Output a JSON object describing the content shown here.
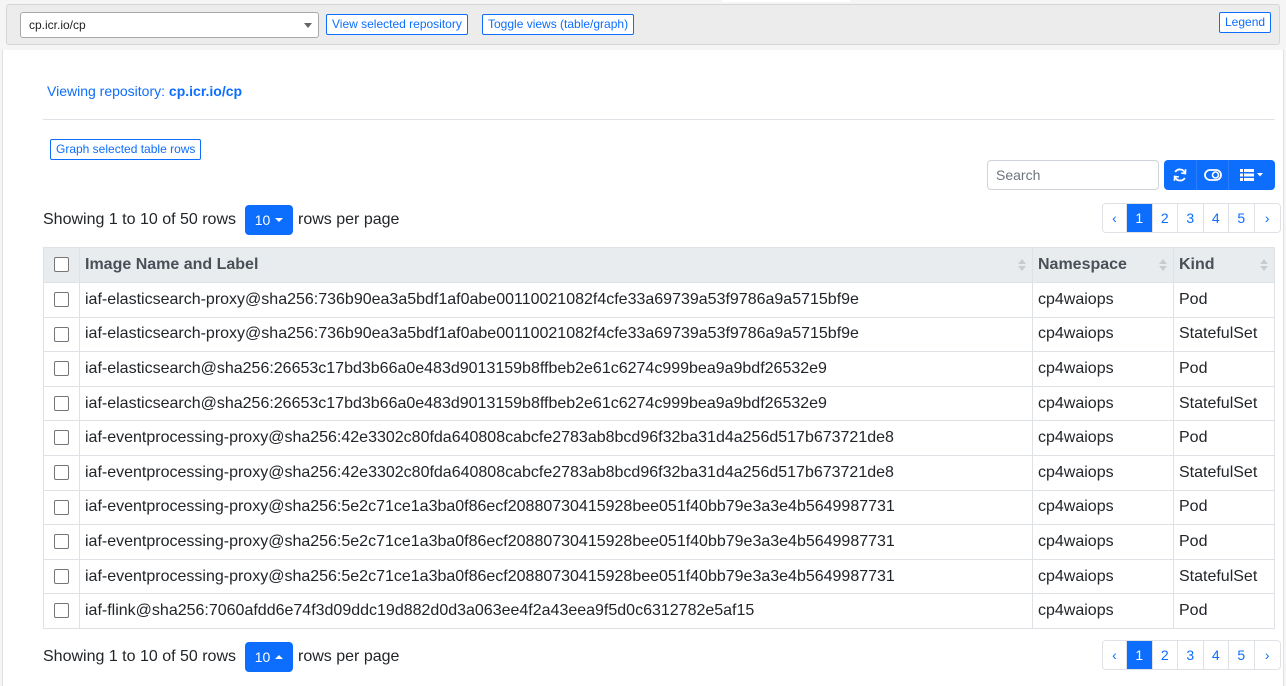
{
  "toolbar": {
    "repo_selected": "cp.icr.io/cp",
    "view_button": "View selected repository",
    "toggle_button": "Toggle views (table/graph)",
    "legend_button": "Legend"
  },
  "viewing": {
    "prefix": "Viewing repository: ",
    "repo": "cp.icr.io/cp"
  },
  "graph_rows_button": "Graph selected table rows",
  "search": {
    "placeholder": "Search"
  },
  "tools": [
    "refresh-icon",
    "toggle-icon",
    "columns-icon"
  ],
  "pagination": {
    "showing_text": "Showing 1 to 10 of 50 rows",
    "page_size": "10",
    "rows_per_page_text": "rows per page",
    "prev": "‹",
    "next": "›",
    "pages": [
      "1",
      "2",
      "3",
      "4",
      "5"
    ],
    "active_page": "1"
  },
  "table": {
    "columns": [
      "Image Name and Label",
      "Namespace",
      "Kind"
    ],
    "rows": [
      {
        "image": "iaf-elasticsearch-proxy@sha256:736b90ea3a5bdf1af0abe00110021082f4cfe33a69739a53f9786a9a5715bf9e",
        "namespace": "cp4waiops",
        "kind": "Pod"
      },
      {
        "image": "iaf-elasticsearch-proxy@sha256:736b90ea3a5bdf1af0abe00110021082f4cfe33a69739a53f9786a9a5715bf9e",
        "namespace": "cp4waiops",
        "kind": "StatefulSet"
      },
      {
        "image": "iaf-elasticsearch@sha256:26653c17bd3b66a0e483d9013159b8ffbeb2e61c6274c999bea9a9bdf26532e9",
        "namespace": "cp4waiops",
        "kind": "Pod"
      },
      {
        "image": "iaf-elasticsearch@sha256:26653c17bd3b66a0e483d9013159b8ffbeb2e61c6274c999bea9a9bdf26532e9",
        "namespace": "cp4waiops",
        "kind": "StatefulSet"
      },
      {
        "image": "iaf-eventprocessing-proxy@sha256:42e3302c80fda640808cabcfe2783ab8bcd96f32ba31d4a256d517b673721de8",
        "namespace": "cp4waiops",
        "kind": "Pod"
      },
      {
        "image": "iaf-eventprocessing-proxy@sha256:42e3302c80fda640808cabcfe2783ab8bcd96f32ba31d4a256d517b673721de8",
        "namespace": "cp4waiops",
        "kind": "StatefulSet"
      },
      {
        "image": "iaf-eventprocessing-proxy@sha256:5e2c71ce1a3ba0f86ecf20880730415928bee051f40bb79e3a3e4b5649987731",
        "namespace": "cp4waiops",
        "kind": "Pod"
      },
      {
        "image": "iaf-eventprocessing-proxy@sha256:5e2c71ce1a3ba0f86ecf20880730415928bee051f40bb79e3a3e4b5649987731",
        "namespace": "cp4waiops",
        "kind": "Pod"
      },
      {
        "image": "iaf-eventprocessing-proxy@sha256:5e2c71ce1a3ba0f86ecf20880730415928bee051f40bb79e3a3e4b5649987731",
        "namespace": "cp4waiops",
        "kind": "StatefulSet"
      },
      {
        "image": "iaf-flink@sha256:7060afdd6e74f3d09ddc19d882d0d3a063ee4f2a43eea9f5d0c6312782e5af15",
        "namespace": "cp4waiops",
        "kind": "Pod"
      }
    ]
  },
  "colors": {
    "primary": "#0d6efd",
    "header_bg": "#e9ecef",
    "border": "#dee2e6"
  }
}
